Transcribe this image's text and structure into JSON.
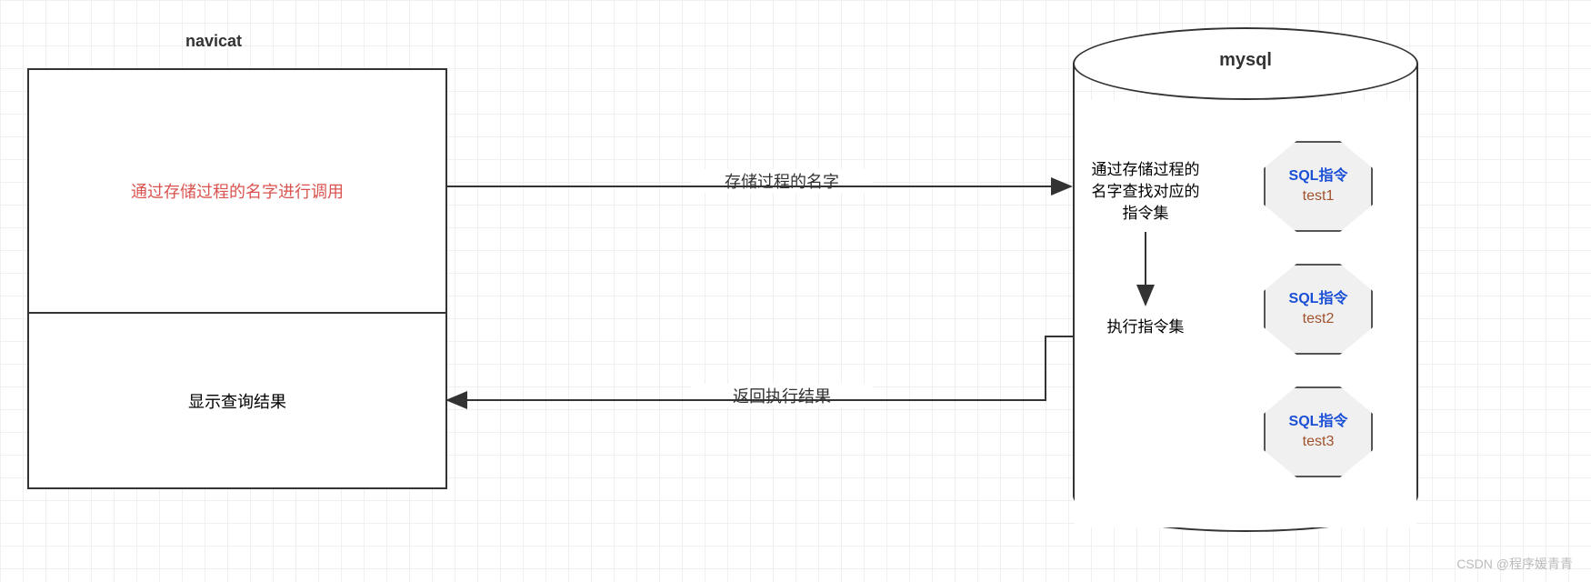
{
  "navicat": {
    "title": "navicat",
    "top_box": "通过存储过程的名字进行调用",
    "bottom_box": "显示查询结果"
  },
  "arrows": {
    "to_mysql": "存储过程的名字",
    "from_mysql": "返回执行结果"
  },
  "mysql": {
    "title": "mysql",
    "lookup_text": "通过存储过程的名字查找对应的指令集",
    "execute_text": "执行指令集",
    "sql_label": "SQL指令",
    "procs": [
      "test1",
      "test2",
      "test3"
    ]
  },
  "watermark": "CSDN @程序媛青青"
}
